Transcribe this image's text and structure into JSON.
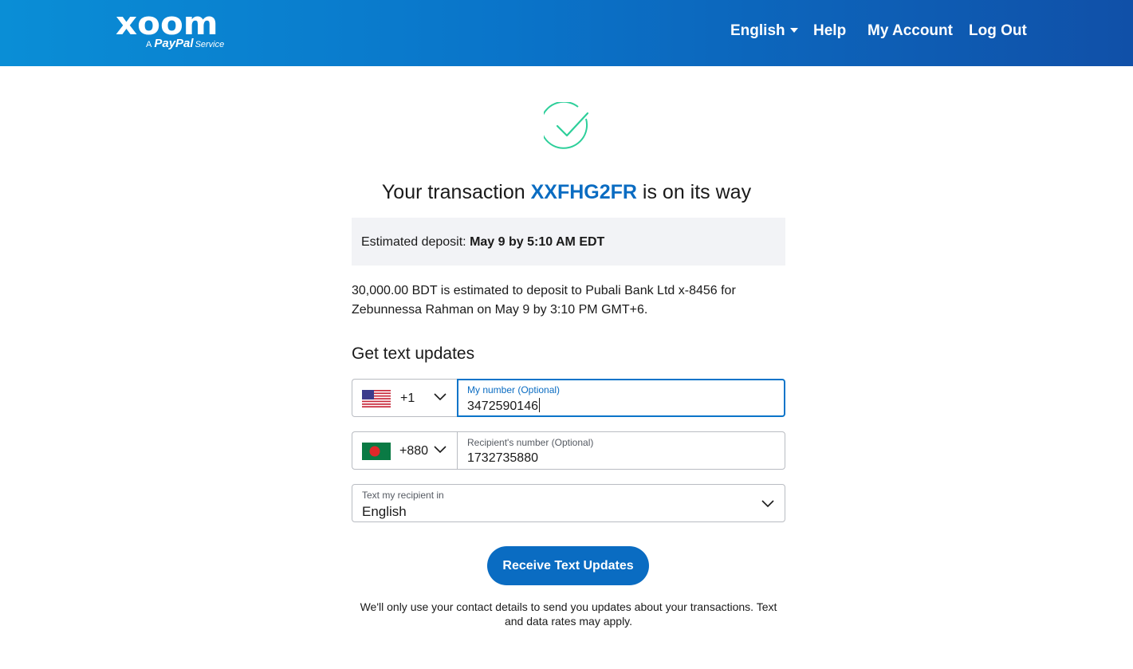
{
  "header": {
    "logo_word": "xoom",
    "logo_prefix": "A",
    "logo_brand": "PayPal",
    "logo_service": "Service",
    "nav": {
      "language": "English",
      "help": "Help",
      "account": "My Account",
      "logout": "Log Out"
    }
  },
  "status": {
    "icon": "check-circle-icon",
    "title_prefix": "Your transaction",
    "transaction_id": "XXFHG2FR",
    "title_suffix": "is on its way"
  },
  "estimate": {
    "label": "Estimated deposit:",
    "value": "May 9 by 5:10 AM EDT"
  },
  "deposit_description": "30,000.00 BDT is estimated to deposit to Pubali Bank Ltd x-8456 for Zebunnessa Rahman on May 9 by 3:10 PM GMT+6.",
  "text_updates": {
    "heading": "Get text updates",
    "my_number": {
      "country_flag": "us-flag-icon",
      "country_code": "+1",
      "label": "My number (Optional)",
      "value": "3472590146"
    },
    "recipient_number": {
      "country_flag": "bangladesh-flag-icon",
      "country_code": "+880",
      "label": "Recipient's number (Optional)",
      "value": "1732735880"
    },
    "language_select": {
      "label": "Text my recipient in",
      "value": "English"
    },
    "submit_label": "Receive Text Updates",
    "disclaimer": "We'll only use your contact details to send you updates about your transactions. Text and data rates may apply."
  },
  "colors": {
    "header_gradient_start": "#0a8ed6",
    "header_gradient_end": "#1050a8",
    "accent": "#0a6cc2",
    "success": "#2dcf9a",
    "panel_bg": "#f2f3f6"
  }
}
